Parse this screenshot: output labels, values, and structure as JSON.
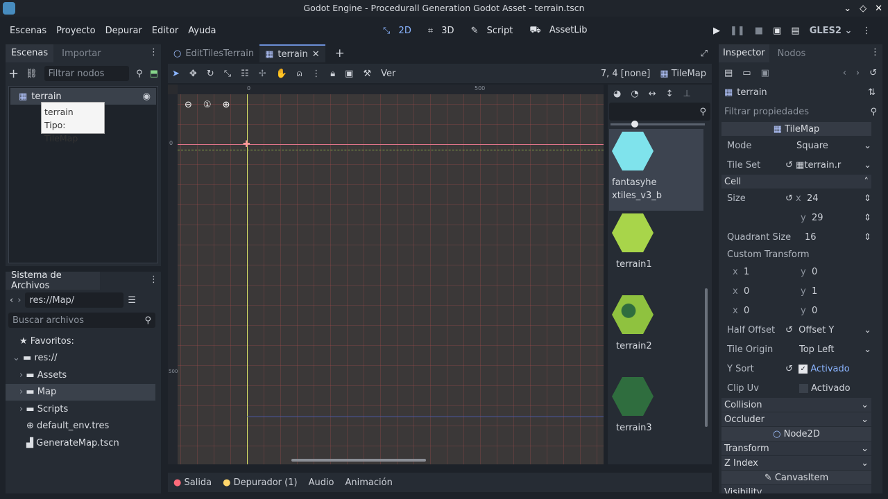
{
  "window": {
    "title": "Godot Engine - Procedurall Generation Godot Asset - terrain.tscn"
  },
  "menu": [
    "Escenas",
    "Proyecto",
    "Depurar",
    "Editor",
    "Ayuda"
  ],
  "main_modes": {
    "d2": "2D",
    "d3": "3D",
    "script": "Script",
    "assetlib": "AssetLib"
  },
  "renderer": "GLES2",
  "scene_dock": {
    "tabs": [
      "Escenas",
      "Importar"
    ],
    "filter_placeholder": "Filtrar nodos",
    "root_node": "terrain",
    "tooltip_line1": "terrain",
    "tooltip_line2": "Tipo: TileMap"
  },
  "filesystem": {
    "title": "Sistema de Archivos",
    "path": "res://Map/",
    "search_placeholder": "Buscar archivos",
    "items": {
      "favorites": "Favoritos:",
      "res": "res://",
      "assets": "Assets",
      "map": "Map",
      "scripts": "Scripts",
      "env": "default_env.tres",
      "gen": "GenerateMap.tscn"
    }
  },
  "editor_tabs": {
    "tab1": "EditTilesTerrain",
    "tab2": "terrain"
  },
  "toolbar": {
    "view_label": "Ver",
    "coords": "7, 4 [none]",
    "tilemap_label": "TileMap"
  },
  "ruler": {
    "h0": "0",
    "h500": "500",
    "v0": "0",
    "v500": "500"
  },
  "tiles": [
    {
      "name1": "fantasyhe",
      "name2": "xtiles_v3_b",
      "color": "#7fe3ec"
    },
    {
      "name1": "terrain1",
      "name2": "",
      "color": "#a8d54a"
    },
    {
      "name1": "terrain2",
      "name2": "",
      "color": "#8fc23f"
    },
    {
      "name1": "terrain3",
      "name2": "",
      "color": "#2f6d3e"
    }
  ],
  "bottom_panel": [
    "Salida",
    "Depurador (1)",
    "Audio",
    "Animación"
  ],
  "inspector": {
    "tabs": [
      "Inspector",
      "Nodos"
    ],
    "node_name": "terrain",
    "filter_placeholder": "Filtrar propiedades",
    "category": "TileMap",
    "mode_label": "Mode",
    "mode_value": "Square",
    "tileset_label": "Tile Set",
    "tileset_value": "terrain.r",
    "cell_section": "Cell",
    "size_label": "Size",
    "size_x": "24",
    "size_y": "29",
    "quad_label": "Quadrant Size",
    "quad_value": "16",
    "custom_transform": "Custom Transform",
    "ct": {
      "x1": "1",
      "y1": "0",
      "x2": "0",
      "y2": "1",
      "x3": "0",
      "y3": "0"
    },
    "half_offset_label": "Half Offset",
    "half_offset_value": "Offset Y",
    "tile_origin_label": "Tile Origin",
    "tile_origin_value": "Top Left",
    "ysort_label": "Y Sort",
    "ysort_value": "Activado",
    "clipuv_label": "Clip Uv",
    "clipuv_value": "Activado",
    "collision": "Collision",
    "occluder": "Occluder",
    "node2d": "Node2D",
    "transform": "Transform",
    "zindex": "Z Index",
    "canvasitem": "CanvasItem",
    "visibility": "Visibility"
  },
  "axis_labels": {
    "x": "x",
    "y": "y"
  }
}
